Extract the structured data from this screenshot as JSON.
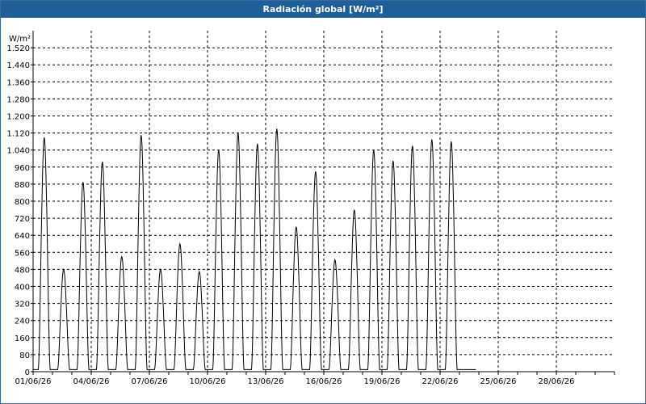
{
  "window": {
    "title": "Radiación global [W/m²]"
  },
  "chart_data": {
    "type": "line",
    "title": "Radiación global [W/m²]",
    "ylabel": "W/m²",
    "xlabel": "",
    "ylim": [
      0,
      1600
    ],
    "xlim": [
      0,
      30
    ],
    "grid": true,
    "y_ticks": [
      0,
      80,
      160,
      240,
      320,
      400,
      480,
      560,
      640,
      720,
      800,
      880,
      960,
      1040,
      1120,
      1200,
      1280,
      1360,
      1440,
      1520
    ],
    "y_tick_labels": [
      "0",
      "80",
      "160",
      "240",
      "320",
      "400",
      "480",
      "560",
      "640",
      "720",
      "800",
      "880",
      "960",
      "1.040",
      "1.120",
      "1.200",
      "1.280",
      "1.360",
      "1.440",
      "1.520"
    ],
    "x_ticks": [
      0,
      3,
      6,
      9,
      12,
      15,
      18,
      21,
      24,
      27
    ],
    "x_tick_labels": [
      "01/06/26",
      "04/06/26",
      "07/06/26",
      "10/06/26",
      "13/06/26",
      "16/06/26",
      "19/06/26",
      "22/06/26",
      "25/06/26",
      "28/06/26"
    ],
    "daily_peaks": [
      {
        "day": "01/06/26",
        "peak": 1100
      },
      {
        "day": "02/06/26",
        "peak": 480
      },
      {
        "day": "03/06/26",
        "peak": 890
      },
      {
        "day": "04/06/26",
        "peak": 985
      },
      {
        "day": "05/06/26",
        "peak": 540
      },
      {
        "day": "06/06/26",
        "peak": 1110
      },
      {
        "day": "07/06/26",
        "peak": 480
      },
      {
        "day": "08/06/26",
        "peak": 600
      },
      {
        "day": "09/06/26",
        "peak": 470
      },
      {
        "day": "10/06/26",
        "peak": 1040
      },
      {
        "day": "11/06/26",
        "peak": 1120
      },
      {
        "day": "12/06/26",
        "peak": 1070
      },
      {
        "day": "13/06/26",
        "peak": 1140
      },
      {
        "day": "14/06/26",
        "peak": 680
      },
      {
        "day": "15/06/26",
        "peak": 940
      },
      {
        "day": "16/06/26",
        "peak": 525
      },
      {
        "day": "17/06/26",
        "peak": 760
      },
      {
        "day": "18/06/26",
        "peak": 1040
      },
      {
        "day": "19/06/26",
        "peak": 990
      },
      {
        "day": "20/06/26",
        "peak": 1060
      },
      {
        "day": "21/06/26",
        "peak": 1090
      },
      {
        "day": "22/06/26",
        "peak": 1080
      }
    ],
    "night_level": 10,
    "data_end_day": 22.85
  }
}
